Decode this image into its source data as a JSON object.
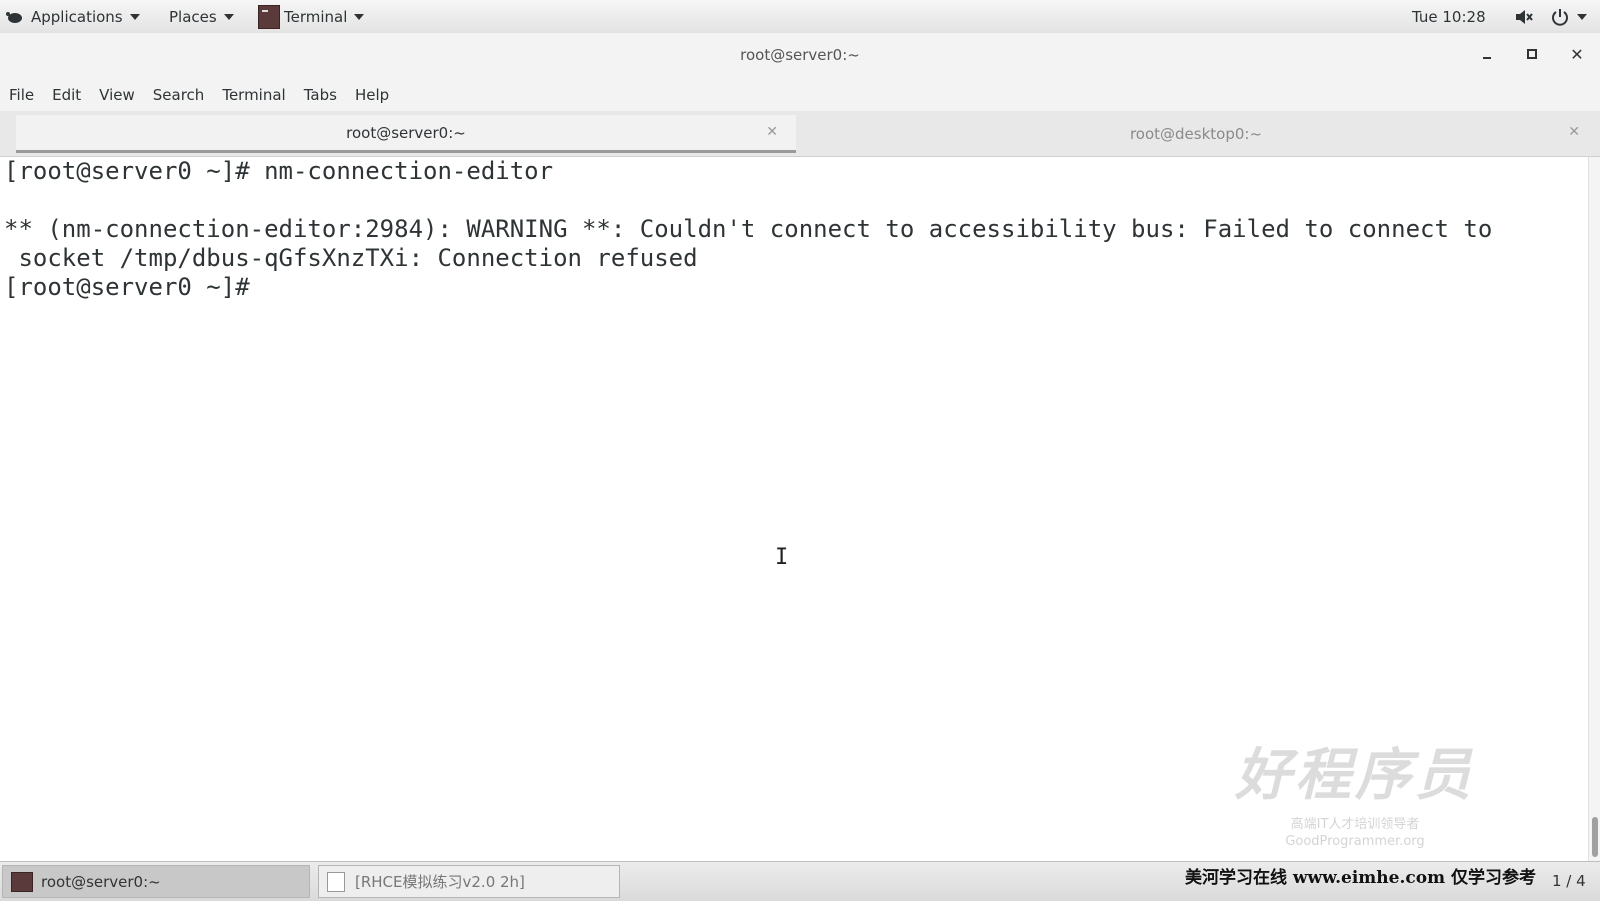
{
  "top_panel": {
    "applications_label": "Applications",
    "places_label": "Places",
    "terminal_label": "Terminal",
    "clock": "Tue 10:28"
  },
  "window": {
    "title": "root@server0:~"
  },
  "menubar": {
    "items": [
      "File",
      "Edit",
      "View",
      "Search",
      "Terminal",
      "Tabs",
      "Help"
    ]
  },
  "tabs": [
    {
      "label": "root@server0:~",
      "active": true
    },
    {
      "label": "root@desktop0:~",
      "active": false
    }
  ],
  "terminal": {
    "lines": [
      "[root@server0 ~]# nm-connection-editor",
      "",
      "** (nm-connection-editor:2984): WARNING **: Couldn't connect to accessibility bus: Failed to connect to",
      " socket /tmp/dbus-qGfsXnzTXi: Connection refused",
      "[root@server0 ~]#"
    ]
  },
  "watermark": {
    "logo_text": "好程序员",
    "slogan": "高端IT人才培训领导者",
    "url": "GoodProgrammer.org"
  },
  "taskbar": {
    "items": [
      {
        "label": "root@server0:~",
        "active": true
      },
      {
        "label": "[RHCE模拟练习v2.0 2h]",
        "active": false
      }
    ]
  },
  "footer": {
    "text": "美河学习在线 www.eimhe.com 仅学习参考",
    "page": "1 / 4"
  },
  "colors": {
    "panel_bg": "#e8e8e8",
    "terminal_bg": "#ffffff",
    "terminal_fg": "#2e3436",
    "inactive_tab_fg": "#8a8a8a"
  }
}
